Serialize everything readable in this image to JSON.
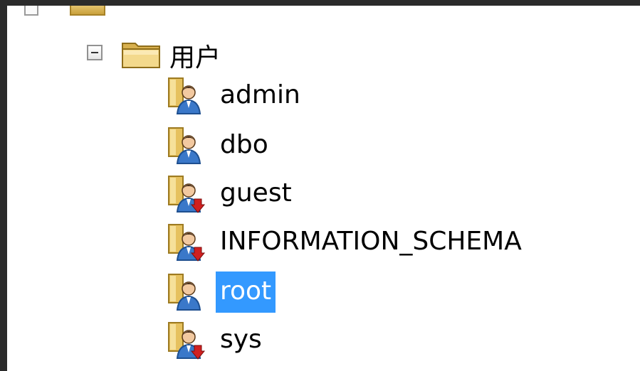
{
  "tree": {
    "folder": {
      "label": "用户",
      "expanded": true
    },
    "users": [
      {
        "name": "admin",
        "has_down_arrow": false,
        "selected": false
      },
      {
        "name": "dbo",
        "has_down_arrow": false,
        "selected": false
      },
      {
        "name": "guest",
        "has_down_arrow": true,
        "selected": false
      },
      {
        "name": "INFORMATION_SCHEMA",
        "has_down_arrow": true,
        "selected": false
      },
      {
        "name": "root",
        "has_down_arrow": false,
        "selected": true
      },
      {
        "name": "sys",
        "has_down_arrow": true,
        "selected": false
      }
    ]
  },
  "colors": {
    "selection": "#3399ff",
    "background": "#ffffff",
    "frame": "#2b2b2b",
    "folder": "#e2bd5a",
    "user_shirt": "#3a78c9",
    "down_arrow": "#d02020"
  }
}
